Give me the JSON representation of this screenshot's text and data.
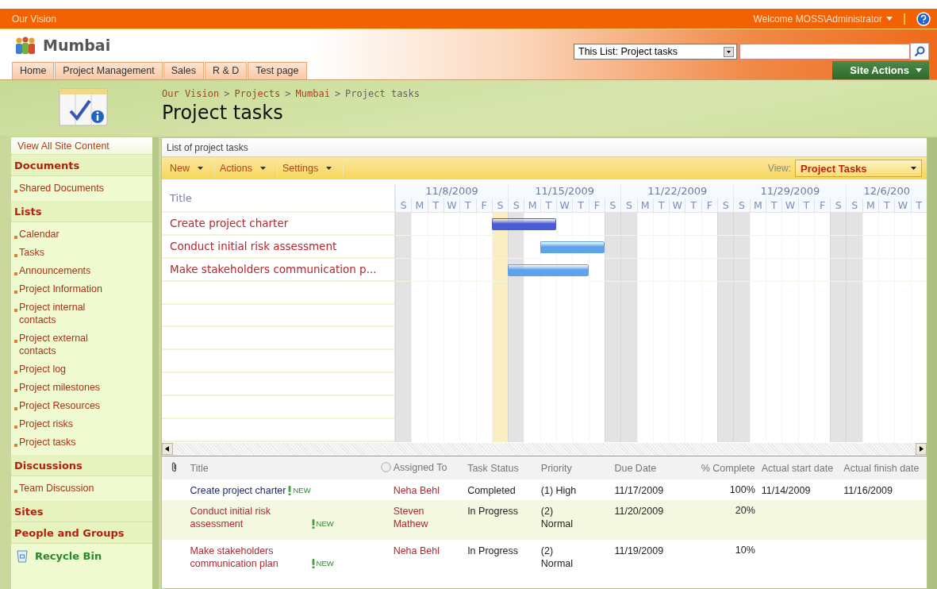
{
  "top_bar": {
    "site": "Our Vision",
    "welcome": "Welcome MOSS\\Administrator"
  },
  "header": {
    "site_title": "Mumbai",
    "search_scope": "This List: Project tasks",
    "site_actions": "Site Actions"
  },
  "top_nav": [
    {
      "label": "Home",
      "selected": false
    },
    {
      "label": "Project Management",
      "selected": false
    },
    {
      "label": "Sales",
      "selected": false
    },
    {
      "label": "R & D",
      "selected": false
    },
    {
      "label": "Test page",
      "selected": false
    }
  ],
  "breadcrumb": [
    {
      "label": "Our Vision",
      "link": true
    },
    {
      "separator": ">",
      "label": "Projects",
      "link": true
    },
    {
      "separator": ">",
      "label": "Mumbai",
      "link": true
    },
    {
      "separator": ">",
      "label": "Project tasks",
      "link": false
    }
  ],
  "page_title": "Project tasks",
  "sidebar": {
    "view_all": "View All Site Content",
    "sections": [
      {
        "heading": "Documents",
        "items": [
          "Shared Documents"
        ]
      },
      {
        "heading": "Lists",
        "items": [
          "Calendar",
          "Tasks",
          "Announcements",
          "Project Information",
          "Project internal contacts",
          "Project external contacts",
          "Project log",
          "Project milestones",
          "Project Resources",
          "Project risks",
          "Project tasks"
        ]
      },
      {
        "heading": "Discussions",
        "items": [
          "Team Discussion"
        ]
      },
      {
        "heading": "Sites"
      },
      {
        "heading": "People and Groups"
      }
    ],
    "recycle_bin": "Recycle Bin"
  },
  "list_description": "List of project tasks",
  "toolbar": {
    "menus": [
      "New",
      "Actions",
      "Settings"
    ],
    "view_label": "View:",
    "view": "Project Tasks"
  },
  "gantt": {
    "title_header": "Title",
    "weeks": [
      {
        "label": "11/8/2009",
        "days": [
          {
            "label": "S",
            "weekend": true,
            "today": false
          },
          {
            "label": "M",
            "weekend": false,
            "today": false
          },
          {
            "label": "T",
            "weekend": false,
            "today": false
          },
          {
            "label": "W",
            "weekend": false,
            "today": false
          },
          {
            "label": "T",
            "weekend": false,
            "today": false
          },
          {
            "label": "F",
            "weekend": false,
            "today": false
          },
          {
            "label": "S",
            "weekend": true,
            "today": true
          }
        ]
      },
      {
        "label": "11/15/2009",
        "days": [
          {
            "label": "S",
            "weekend": true,
            "today": false
          },
          {
            "label": "M",
            "weekend": false,
            "today": false
          },
          {
            "label": "T",
            "weekend": false,
            "today": false
          },
          {
            "label": "W",
            "weekend": false,
            "today": false
          },
          {
            "label": "T",
            "weekend": false,
            "today": false
          },
          {
            "label": "F",
            "weekend": false,
            "today": false
          },
          {
            "label": "S",
            "weekend": true,
            "today": false
          }
        ]
      },
      {
        "label": "11/22/2009",
        "days": [
          {
            "label": "S",
            "weekend": true,
            "today": false
          },
          {
            "label": "M",
            "weekend": false,
            "today": false
          },
          {
            "label": "T",
            "weekend": false,
            "today": false
          },
          {
            "label": "W",
            "weekend": false,
            "today": false
          },
          {
            "label": "T",
            "weekend": false,
            "today": false
          },
          {
            "label": "F",
            "weekend": false,
            "today": false
          },
          {
            "label": "S",
            "weekend": true,
            "today": false
          }
        ]
      },
      {
        "label": "11/29/2009",
        "days": [
          {
            "label": "S",
            "weekend": true,
            "today": false
          },
          {
            "label": "M",
            "weekend": false,
            "today": false
          },
          {
            "label": "T",
            "weekend": false,
            "today": false
          },
          {
            "label": "W",
            "weekend": false,
            "today": false
          },
          {
            "label": "T",
            "weekend": false,
            "today": false
          },
          {
            "label": "F",
            "weekend": false,
            "today": false
          },
          {
            "label": "S",
            "weekend": true,
            "today": false
          }
        ]
      },
      {
        "label": "12/6/200",
        "days": [
          {
            "label": "S",
            "weekend": true,
            "today": false
          },
          {
            "label": "M",
            "weekend": false,
            "today": false
          },
          {
            "label": "T",
            "weekend": false,
            "today": false
          },
          {
            "label": "W",
            "weekend": false,
            "today": false
          },
          {
            "label": "T",
            "weekend": false,
            "today": false
          }
        ]
      }
    ],
    "rows": [
      {
        "title": "Create project charter",
        "color": "#4a5cd4",
        "days": [
          {
            "bar": false
          },
          {
            "bar": false
          },
          {
            "bar": false
          },
          {
            "bar": false
          },
          {
            "bar": false
          },
          {
            "bar": false
          },
          {
            "bar": true
          },
          {
            "bar": true
          },
          {
            "bar": true
          },
          {
            "bar": true
          },
          {
            "bar": false
          },
          {
            "bar": false
          },
          {
            "bar": false
          },
          {
            "bar": false
          },
          {
            "bar": false
          },
          {
            "bar": false
          },
          {
            "bar": false
          },
          {
            "bar": false
          },
          {
            "bar": false
          },
          {
            "bar": false
          },
          {
            "bar": false
          },
          {
            "bar": false
          },
          {
            "bar": false
          },
          {
            "bar": false
          },
          {
            "bar": false
          },
          {
            "bar": false
          },
          {
            "bar": false
          },
          {
            "bar": false
          },
          {
            "bar": false
          },
          {
            "bar": false
          },
          {
            "bar": false
          },
          {
            "bar": false
          },
          {
            "bar": false
          }
        ]
      },
      {
        "title": "Conduct initial risk assessment",
        "color": "#5ea2ec",
        "days": [
          {
            "bar": false
          },
          {
            "bar": false
          },
          {
            "bar": false
          },
          {
            "bar": false
          },
          {
            "bar": false
          },
          {
            "bar": false
          },
          {
            "bar": false
          },
          {
            "bar": false
          },
          {
            "bar": false
          },
          {
            "bar": true
          },
          {
            "bar": true
          },
          {
            "bar": true
          },
          {
            "bar": true
          },
          {
            "bar": false
          },
          {
            "bar": false
          },
          {
            "bar": false
          },
          {
            "bar": false
          },
          {
            "bar": false
          },
          {
            "bar": false
          },
          {
            "bar": false
          },
          {
            "bar": false
          },
          {
            "bar": false
          },
          {
            "bar": false
          },
          {
            "bar": false
          },
          {
            "bar": false
          },
          {
            "bar": false
          },
          {
            "bar": false
          },
          {
            "bar": false
          },
          {
            "bar": false
          },
          {
            "bar": false
          },
          {
            "bar": false
          },
          {
            "bar": false
          },
          {
            "bar": false
          }
        ]
      },
      {
        "title": "Make stakeholders communication p...",
        "color": "#5ea2ec",
        "days": [
          {
            "bar": false
          },
          {
            "bar": false
          },
          {
            "bar": false
          },
          {
            "bar": false
          },
          {
            "bar": false
          },
          {
            "bar": false
          },
          {
            "bar": false
          },
          {
            "bar": true
          },
          {
            "bar": true
          },
          {
            "bar": true
          },
          {
            "bar": true
          },
          {
            "bar": true
          },
          {
            "bar": false
          },
          {
            "bar": false
          },
          {
            "bar": false
          },
          {
            "bar": false
          },
          {
            "bar": false
          },
          {
            "bar": false
          },
          {
            "bar": false
          },
          {
            "bar": false
          },
          {
            "bar": false
          },
          {
            "bar": false
          },
          {
            "bar": false
          },
          {
            "bar": false
          },
          {
            "bar": false
          },
          {
            "bar": false
          },
          {
            "bar": false
          },
          {
            "bar": false
          },
          {
            "bar": false
          },
          {
            "bar": false
          },
          {
            "bar": false
          },
          {
            "bar": false
          },
          {
            "bar": false
          }
        ]
      }
    ]
  },
  "tasks": {
    "columns": [
      {
        "kind": "attachment"
      },
      {
        "kind": "title",
        "label": "Title"
      },
      {
        "kind": "person",
        "label": "Assigned To"
      },
      {
        "kind": "text",
        "label": "Task Status"
      },
      {
        "kind": "text",
        "label": "Priority"
      },
      {
        "kind": "text",
        "label": "Due Date"
      },
      {
        "kind": "number",
        "label": "% Complete"
      },
      {
        "kind": "text",
        "label": "Actual start date"
      },
      {
        "kind": "text",
        "label": "Actual finish date"
      }
    ],
    "rows": [
      {
        "visited": true,
        "new_badge": "NEW",
        "cells": [
          "",
          "Create project charter",
          "Neha Behl",
          "Completed",
          "(1) High",
          "11/17/2009",
          "100%",
          "11/14/2009",
          "11/16/2009"
        ]
      },
      {
        "visited": false,
        "new_badge": "NEW",
        "cells": [
          "",
          "Conduct initial risk assessment",
          "Steven Mathew",
          "In Progress",
          "(2) Normal",
          "11/20/2009",
          "20%"
        ]
      },
      {
        "visited": false,
        "new_badge": "NEW",
        "cells": [
          "",
          "Make stakeholders communication plan",
          "Neha Behl",
          "In Progress",
          "(2) Normal",
          "11/19/2009",
          "10%"
        ]
      }
    ]
  }
}
